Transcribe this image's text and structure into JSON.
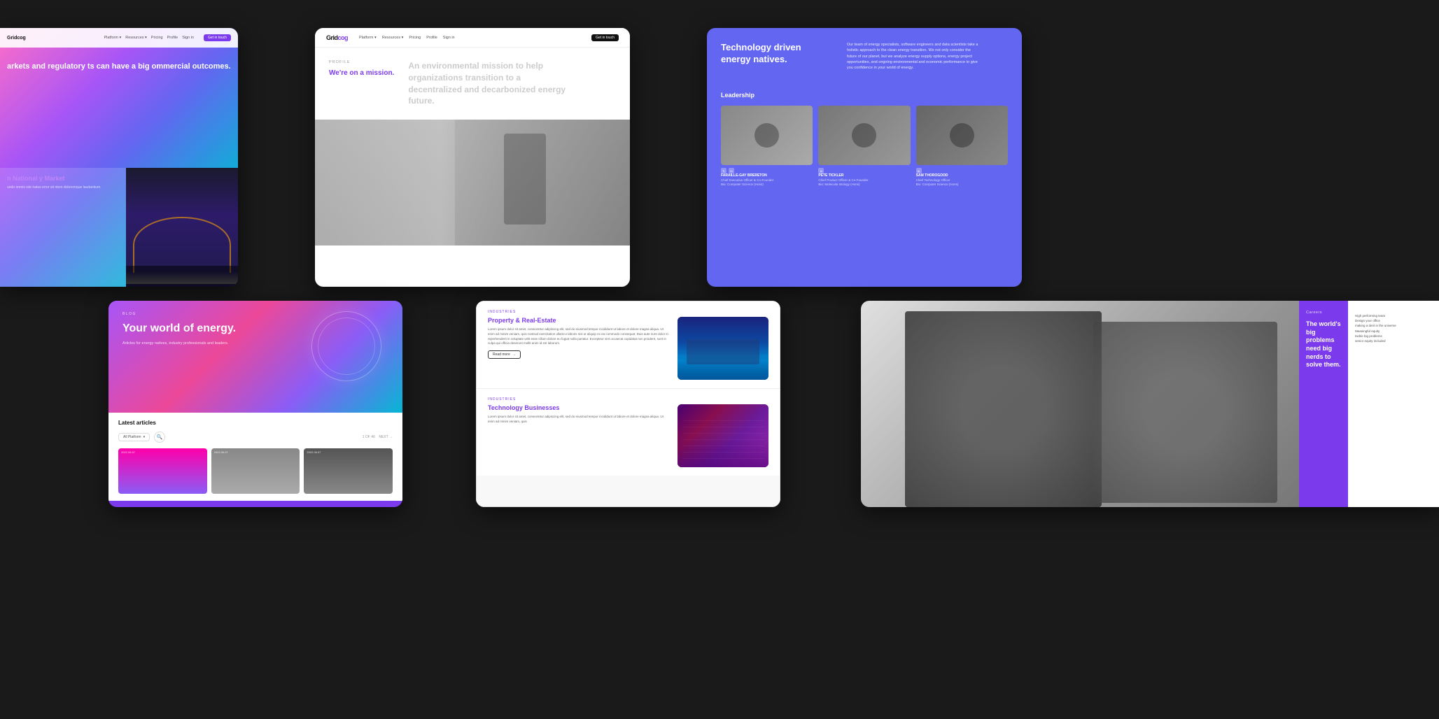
{
  "background": "#1a1a1a",
  "screens": {
    "screen1": {
      "nav": {
        "brand": "Gridcog",
        "links": [
          "Platform",
          "Resources",
          "Pricing",
          "Profile",
          "Sign in"
        ],
        "cta": "Get in touch"
      },
      "headline": "arkets and regulatory ts can have a big ommercial outcomes.",
      "card_title": "n National y Market",
      "card_text": "undo omnis iste natus error sit ntem doloremque laudantium."
    },
    "screen2": {
      "logo": "Gridcog",
      "nav_links": [
        "Platform",
        "Resources",
        "Pricing",
        "Profile",
        "Sign in"
      ],
      "cta": "Get in touch",
      "page_label": "PROFILE",
      "tagline": "We're on a mission.",
      "mission_text": "An environmental mission to help organizations transition to a decentralized and decarbonized energy future."
    },
    "screen3": {
      "headline": "Technology driven energy natives.",
      "description": "Our team of energy specialists, software engineers and data scientists take a holistic approach to the clean energy transition. We not only consider the future of our planet, but we analyze energy supply options, energy project opportunities, and ongoing environmental and economic performance to give you confidence in your world of energy.",
      "leadership_title": "Leadership",
      "team": [
        {
          "name": "FARAILLE-GAY BRERETON",
          "role": "Chief Executive Officer & Co-Founder",
          "bio": "Bio: Computer Science (Hons)"
        },
        {
          "name": "PETE TICKLER",
          "role": "Chief Product Officer & Co-Founder",
          "bio": "Bio: Molecular Biology (Hons)"
        },
        {
          "name": "SAM THOROGOOD",
          "role": "Chief Technology Officer",
          "bio": "Bio: Computer Science (Hons)"
        }
      ]
    },
    "screen4": {
      "label": "BLOG",
      "title": "Your world of energy.",
      "subtitle": "Articles for energy natives, industry professionals and leaders.",
      "articles_section": "Latest articles",
      "filter": "All Platform",
      "pagination": "1 OF 40",
      "next": "NEXT",
      "dates": [
        "2022.06.07",
        "2022.06.07",
        "2022.06.07"
      ]
    },
    "screen5": {
      "sections": [
        {
          "industry_label": "INDUSTRIES",
          "title": "Property & Real-Estate",
          "body": "Lorem ipsum dolor sit amet, consectetur adipiscing elit, sed do eiusmod tempor incididunt ut labore et dolore magna aliqua. Ut enim ad minim veniam, quis nostrud exercitation ullamco laboris nisi ut aliquip ex ea commodo consequat. Duis aute irure dolor in reprehenderit in voluptate velit esse cillum dolore eu fugiat nulla pariatur. Excepteur sint occaecat cupidatat non proident, sunt in culpa qui officia deserunt mollit anim id est laborum.",
          "read_more": "Read more"
        },
        {
          "industry_label": "INDUSTRIES",
          "title": "Technology Businesses",
          "body": "Lorem ipsum dolor sit amet, consectetur adipiscing elit, sed do eiusmod tempor incididunt ut labore et dolore magna aliqua. Ut enim ad minim veniam, quis"
        }
      ]
    },
    "screen6": {
      "careers_label": "Careers",
      "headline": "The world's big problems need big nerds to solve them.",
      "list_items": [
        "High performing team",
        "Design your office",
        "making a dent in the universe",
        "Meaningful equity",
        "tackle big problems",
        "senior equity included"
      ]
    }
  }
}
